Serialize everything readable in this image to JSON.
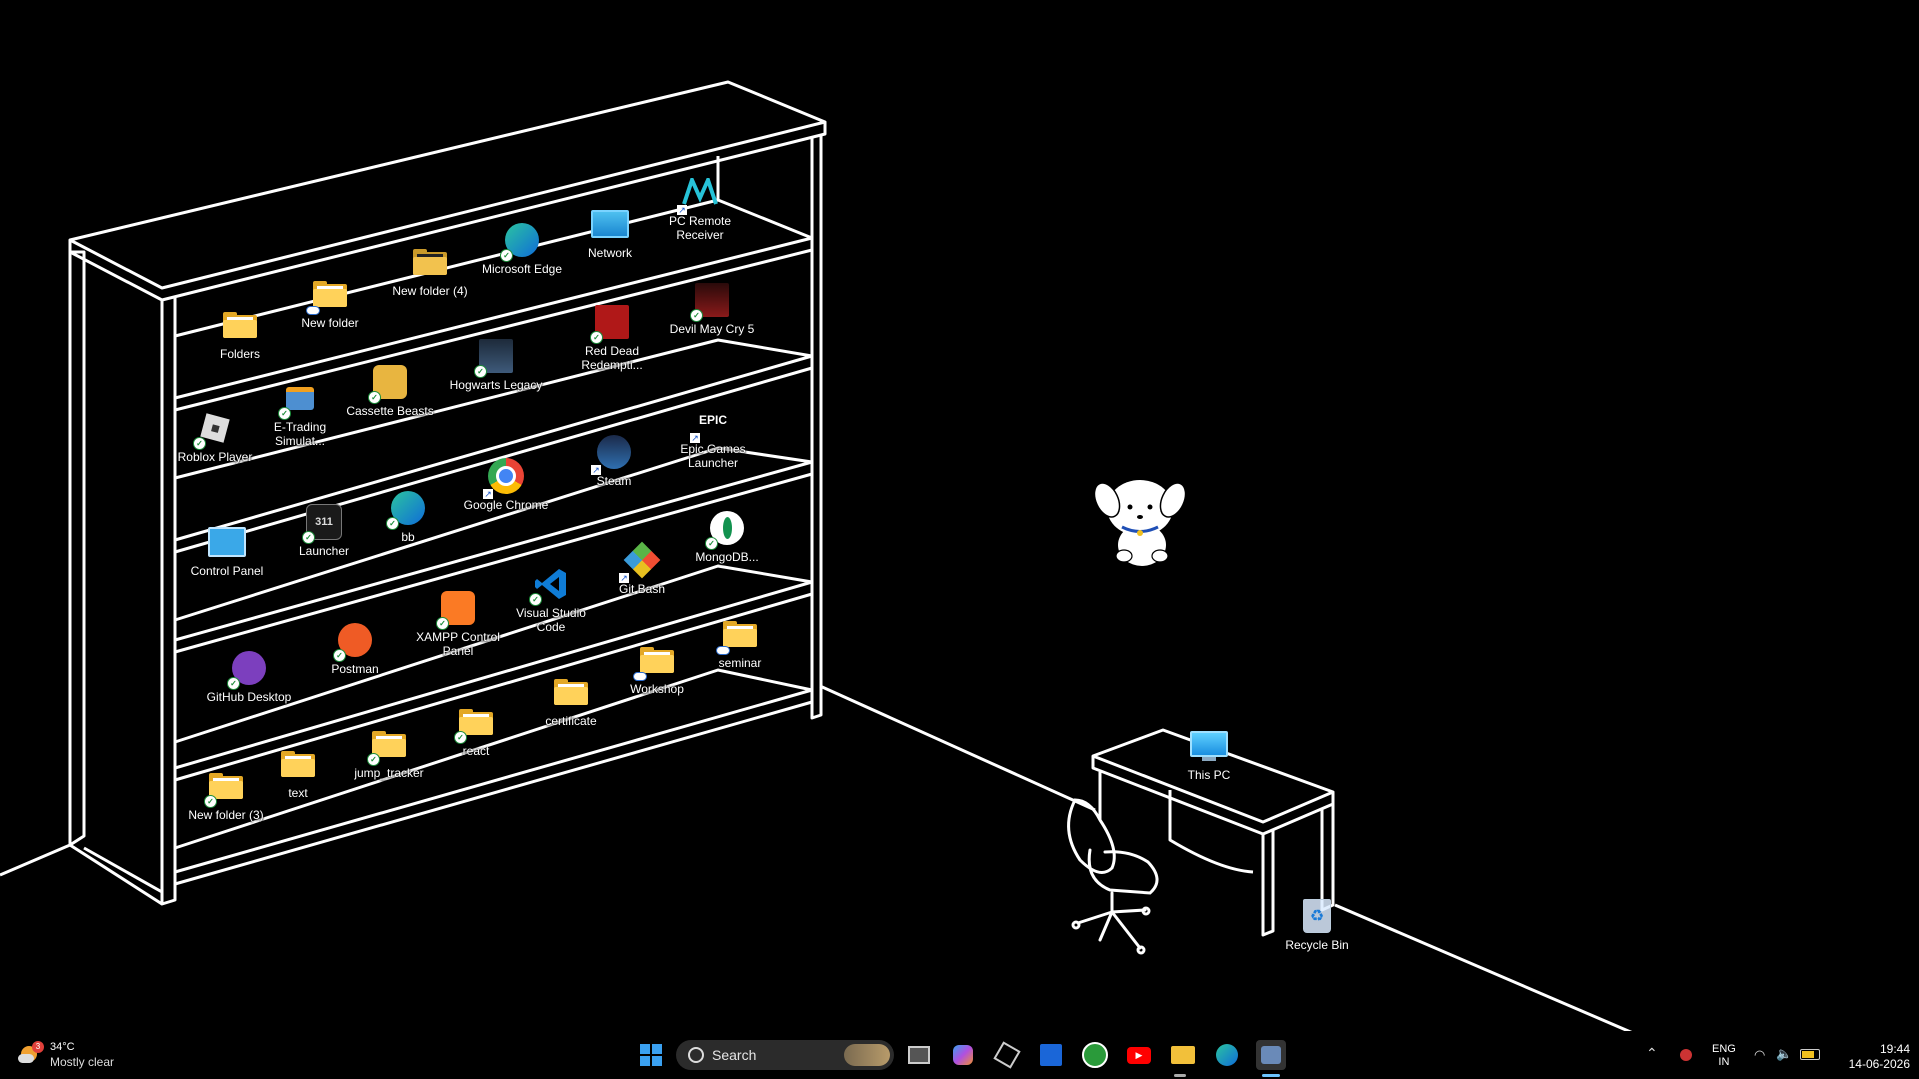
{
  "desktop_icons": {
    "folders": "Folders",
    "new_folder": "New folder",
    "new_folder_4": "New folder (4)",
    "microsoft_edge": "Microsoft Edge",
    "network": "Network",
    "pc_remote_receiver": "PC Remote Receiver",
    "roblox_player": "Roblox Player",
    "e_trading": "E-Trading Simulat...",
    "cassette_beasts": "Cassette Beasts",
    "hogwarts_legacy": "Hogwarts Legacy",
    "red_dead": "Red Dead Redempti...",
    "devil_may_cry": "Devil May Cry 5",
    "control_panel": "Control Panel",
    "launcher": "Launcher",
    "bb": "bb",
    "google_chrome": "Google Chrome",
    "steam": "Steam",
    "epic_games": "Epic Games Launcher",
    "github_desktop": "GitHub Desktop",
    "postman": "Postman",
    "xampp": "XAMPP Control Panel",
    "vscode": "Visual Studio Code",
    "git_bash": "Git Bash",
    "mongodb": "MongoDB...",
    "new_folder_3": "New folder (3)",
    "text": "text",
    "jump_tracker": "jump_tracker",
    "react": "react",
    "certificate": "certificate",
    "workshop": "Workshop",
    "seminar": "seminar",
    "this_pc": "This PC",
    "recycle_bin": "Recycle Bin"
  },
  "icon_text": {
    "epic_logo": "EPIC",
    "launcher_badge": "311"
  },
  "taskbar": {
    "weather": {
      "temp": "34°C",
      "condition": "Mostly clear",
      "badge": "3"
    },
    "search_label": "Search",
    "pinned_icons": [
      "start-icon",
      "task-view-icon",
      "copilot-icon",
      "unity-icon",
      "mcafee-icon",
      "xbox-icon",
      "youtube-icon",
      "file-explorer-icon",
      "edge-icon",
      "active-app-icon"
    ],
    "language": {
      "line1": "ENG",
      "line2": "IN"
    },
    "clock": {
      "time": "19:44",
      "date": "14-06-2026"
    }
  },
  "colors": {
    "background": "#000000",
    "line_art": "#ffffff",
    "folder": "#ffd25a",
    "sync_check": "#1c8d3a",
    "taskbar_search": "#2b2b2b"
  }
}
